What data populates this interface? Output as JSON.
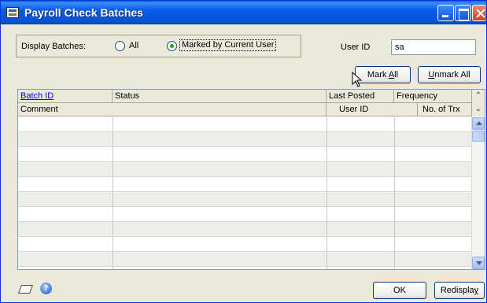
{
  "window": {
    "title": "Payroll Check Batches"
  },
  "filter": {
    "label": "Display Batches:",
    "options": [
      {
        "label": "All",
        "selected": false
      },
      {
        "label": "Marked by Current User",
        "selected": true
      }
    ]
  },
  "user": {
    "label": "User ID",
    "value": "sa"
  },
  "buttons": {
    "mark_all": {
      "pre": "Mark ",
      "ul": "A",
      "post": "ll"
    },
    "unmark_all": {
      "pre": "",
      "ul": "U",
      "post": "nmark All"
    },
    "ok": "OK",
    "redisplay": {
      "pre": "Redispla",
      "ul": "y",
      "post": ""
    }
  },
  "grid": {
    "header1": [
      "Batch ID",
      "Status",
      "Last Posted",
      "Frequency"
    ],
    "header2": [
      "Comment",
      "User ID",
      "No. of Trx"
    ],
    "expand_icon": "double-chevron-up-icon",
    "collapse_icon": "double-chevron-down-icon",
    "row_count": 10
  },
  "colors": {
    "accent": "#0a5bd6",
    "link": "#0000ee",
    "row_alt": "#eeeee8"
  }
}
